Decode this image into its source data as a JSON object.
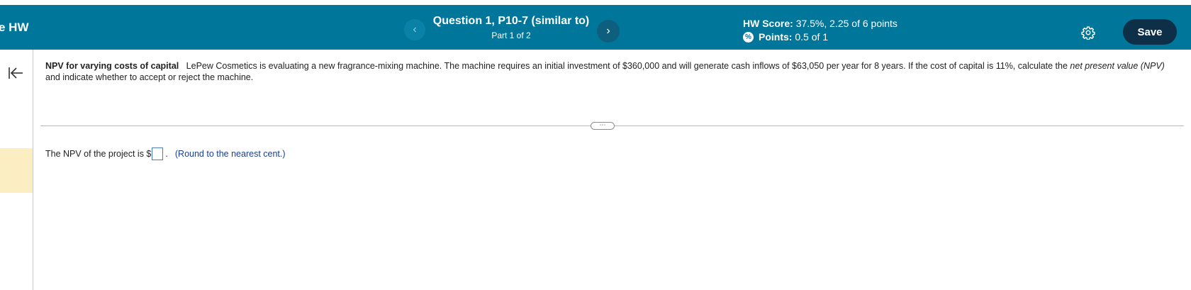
{
  "header": {
    "hw_title": "e HW",
    "question_title": "Question 1, P10-7 (similar to)",
    "part_label": "Part 1 of 2",
    "prev_glyph": "‹",
    "next_glyph": "›",
    "score_label": "HW Score:",
    "score_value": "37.5%, 2.25 of 6 points",
    "points_label": "Points:",
    "points_value": "0.5 of 1",
    "points_icon_glyph": "%",
    "save_label": "Save"
  },
  "question": {
    "title": "NPV for varying costs of capital",
    "body": "LePew Cosmetics is evaluating a new fragrance-mixing machine.  The machine requires an initial investment of $360,000 and will generate cash inflows of $63,050 per year for 8 years.  If the cost of capital is 11%, calculate the ",
    "italic_term": "net present value (NPV)",
    "body_end": " and indicate whether to accept or reject the machine."
  },
  "divider": {
    "expand_glyph": "⋯"
  },
  "answer": {
    "prefix": "The NPV of the project is $",
    "input_value": "",
    "suffix": ".",
    "hint": "(Round to the nearest cent.)"
  },
  "colors": {
    "header_bg": "#01769b",
    "save_bg": "#0d2f47",
    "sidebar_highlight": "#fbeec2",
    "hint_text": "#1b3f8f"
  },
  "icons": {
    "settings": "gear-icon",
    "collapse": "collapse-left-icon",
    "points_status": "partial-credit-icon"
  }
}
